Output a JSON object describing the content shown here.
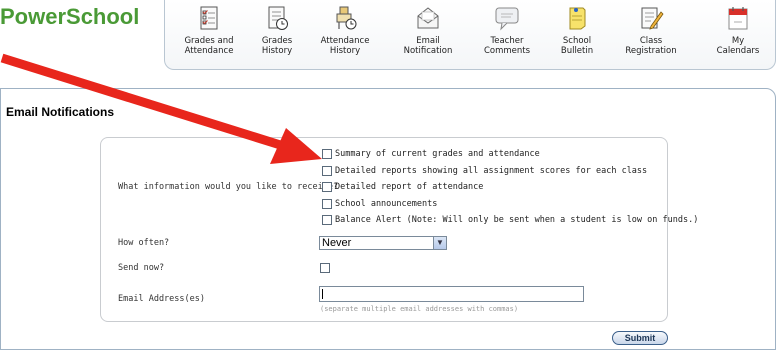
{
  "app": {
    "logo_text": "PowerSchool"
  },
  "nav": {
    "items": [
      {
        "label": "Grades and\nAttendance",
        "icon": "grades-attendance-icon"
      },
      {
        "label": "Grades\nHistory",
        "icon": "grades-history-icon"
      },
      {
        "label": "Attendance\nHistory",
        "icon": "attendance-history-icon"
      },
      {
        "label": "Email\nNotification",
        "icon": "envelope-icon"
      },
      {
        "label": "Teacher\nComments",
        "icon": "speech-bubble-icon"
      },
      {
        "label": "School\nBulletin",
        "icon": "bulletin-note-icon"
      },
      {
        "label": "Class\nRegistration",
        "icon": "registration-pencil-icon"
      },
      {
        "label": "My\nCalendars",
        "icon": "calendar-icon"
      }
    ]
  },
  "page": {
    "title": "Email Notifications"
  },
  "form": {
    "what_label": "What information would you like to receive?",
    "options": [
      "Summary of current grades and attendance",
      "Detailed reports showing all assignment scores for each class",
      "Detailed report of attendance",
      "School announcements",
      "Balance Alert (Note: Will only be sent when a student is low on funds.)"
    ],
    "how_often_label": "How often?",
    "how_often_value": "Never",
    "send_now_label": "Send now?",
    "email_label": "Email Address(es)",
    "email_value": "",
    "email_hint": "(separate multiple email addresses with commas)",
    "submit_label": "Submit"
  },
  "colors": {
    "logo": "#4a9a36",
    "annotation_arrow": "#e8261c",
    "panel_border": "#9fb2c4"
  }
}
